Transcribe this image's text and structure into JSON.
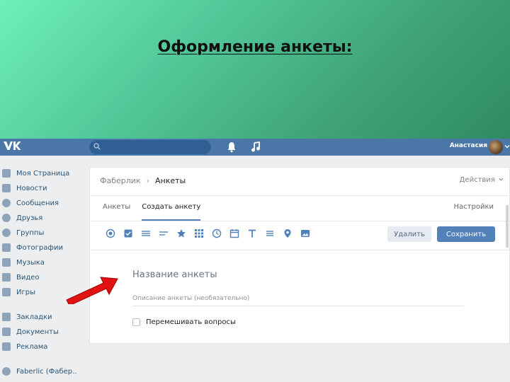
{
  "slide": {
    "title": "Оформление анкеты:",
    "bg_color": "#52c99a"
  },
  "header": {
    "logo_text": "VK",
    "search_icon": "search-icon",
    "bell_icon": "bell-icon",
    "music_icon": "music-icon",
    "user_name": "Анастасия",
    "bar_color": "#4a76a8"
  },
  "sidebar": {
    "items": [
      {
        "label": "Моя Страница",
        "icon": "home-icon"
      },
      {
        "label": "Новости",
        "icon": "news-icon"
      },
      {
        "label": "Сообщения",
        "icon": "messages-icon"
      },
      {
        "label": "Друзья",
        "icon": "friends-icon"
      },
      {
        "label": "Группы",
        "icon": "groups-icon"
      },
      {
        "label": "Фотографии",
        "icon": "camera-icon"
      },
      {
        "label": "Музыка",
        "icon": "music-icon"
      },
      {
        "label": "Видео",
        "icon": "video-icon"
      },
      {
        "label": "Игры",
        "icon": "games-icon"
      },
      {
        "label": "Закладки",
        "icon": "star-icon"
      },
      {
        "label": "Документы",
        "icon": "document-icon"
      },
      {
        "label": "Реклама",
        "icon": "megaphone-icon"
      },
      {
        "label": "Faberlic (Фабер..",
        "icon": "group-icon"
      }
    ]
  },
  "main": {
    "breadcrumb": {
      "parent": "Фаберлик",
      "separator": "›",
      "current": "Анкеты"
    },
    "actions_label": "Действия",
    "tabs": [
      {
        "label": "Анкеты",
        "active": false
      },
      {
        "label": "Создать анкету",
        "active": true
      }
    ],
    "settings_label": "Настройки",
    "toolbar_icons": [
      "radio-icon",
      "checkbox-icon",
      "list-icon",
      "text-lines-icon",
      "star-rating-icon",
      "grid-icon",
      "clock-icon",
      "calendar-icon",
      "text-t-icon",
      "equals-icon",
      "location-pin-icon",
      "image-icon"
    ],
    "delete_label": "Удалить",
    "save_label": "Сохранить",
    "form_title_placeholder": "Название анкеты",
    "form_desc_placeholder": "Описание анкеты (необязательно)",
    "shuffle_label": "Перемешивать вопросы",
    "accent_color": "#5181b8"
  },
  "annotation": {
    "arrow_color": "#e31212"
  }
}
